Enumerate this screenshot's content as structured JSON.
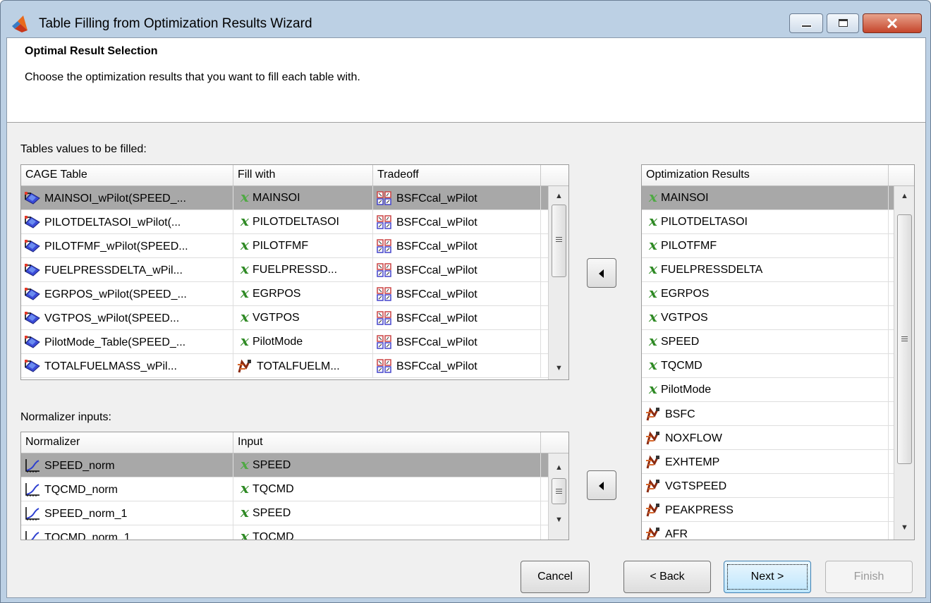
{
  "window": {
    "title": "Table Filling from Optimization Results Wizard",
    "controls": [
      "minimize-icon",
      "maximize-icon",
      "close-icon"
    ]
  },
  "header": {
    "title": "Optimal Result Selection",
    "description": "Choose the optimization results that you want to fill each table with."
  },
  "tables_section": {
    "label": "Tables values to be filled:",
    "columns": [
      "CAGE Table",
      "Fill with",
      "Tradeoff"
    ],
    "rows": [
      {
        "table": "MAINSOI_wPilot(SPEED_...",
        "fill": "MAINSOI",
        "fill_icon": "variable-icon",
        "tradeoff": "BSFCcal_wPilot",
        "selected": true
      },
      {
        "table": "PILOTDELTASOI_wPilot(...",
        "fill": "PILOTDELTASOI",
        "fill_icon": "variable-icon",
        "tradeoff": "BSFCcal_wPilot",
        "selected": false
      },
      {
        "table": "PILOTFMF_wPilot(SPEED...",
        "fill": "PILOTFMF",
        "fill_icon": "variable-icon",
        "tradeoff": "BSFCcal_wPilot",
        "selected": false
      },
      {
        "table": "FUELPRESSDELTA_wPil...",
        "fill": "FUELPRESSD...",
        "fill_icon": "variable-icon",
        "tradeoff": "BSFCcal_wPilot",
        "selected": false
      },
      {
        "table": "EGRPOS_wPilot(SPEED_...",
        "fill": "EGRPOS",
        "fill_icon": "variable-icon",
        "tradeoff": "BSFCcal_wPilot",
        "selected": false
      },
      {
        "table": "VGTPOS_wPilot(SPEED...",
        "fill": "VGTPOS",
        "fill_icon": "variable-icon",
        "tradeoff": "BSFCcal_wPilot",
        "selected": false
      },
      {
        "table": "PilotMode_Table(SPEED_...",
        "fill": "PilotMode",
        "fill_icon": "variable-icon",
        "tradeoff": "BSFCcal_wPilot",
        "selected": false
      },
      {
        "table": "TOTALFUELMASS_wPil...",
        "fill": "TOTALFUELM...",
        "fill_icon": "model-icon",
        "tradeoff": "BSFCcal_wPilot",
        "selected": false
      }
    ]
  },
  "normalizer_section": {
    "label": "Normalizer inputs:",
    "columns": [
      "Normalizer",
      "Input"
    ],
    "rows": [
      {
        "normalizer": "SPEED_norm",
        "input": "SPEED",
        "selected": true
      },
      {
        "normalizer": "TQCMD_norm",
        "input": "TQCMD",
        "selected": false
      },
      {
        "normalizer": "SPEED_norm_1",
        "input": "SPEED",
        "selected": false
      },
      {
        "normalizer": "TQCMD_norm_1",
        "input": "TQCMD",
        "selected": false
      }
    ]
  },
  "results_section": {
    "column": "Optimization Results",
    "rows": [
      {
        "name": "MAINSOI",
        "icon": "variable-icon",
        "selected": true
      },
      {
        "name": "PILOTDELTASOI",
        "icon": "variable-icon",
        "selected": false
      },
      {
        "name": "PILOTFMF",
        "icon": "variable-icon",
        "selected": false
      },
      {
        "name": "FUELPRESSDELTA",
        "icon": "variable-icon",
        "selected": false
      },
      {
        "name": "EGRPOS",
        "icon": "variable-icon",
        "selected": false
      },
      {
        "name": "VGTPOS",
        "icon": "variable-icon",
        "selected": false
      },
      {
        "name": "SPEED",
        "icon": "variable-icon",
        "selected": false
      },
      {
        "name": "TQCMD",
        "icon": "variable-icon",
        "selected": false
      },
      {
        "name": "PilotMode",
        "icon": "variable-icon",
        "selected": false
      },
      {
        "name": "BSFC",
        "icon": "model-icon",
        "selected": false
      },
      {
        "name": "NOXFLOW",
        "icon": "model-icon",
        "selected": false
      },
      {
        "name": "EXHTEMP",
        "icon": "model-icon",
        "selected": false
      },
      {
        "name": "VGTSPEED",
        "icon": "model-icon",
        "selected": false
      },
      {
        "name": "PEAKPRESS",
        "icon": "model-icon",
        "selected": false
      },
      {
        "name": "AFR",
        "icon": "model-icon",
        "selected": false
      }
    ]
  },
  "buttons": {
    "cancel": "Cancel",
    "back": "< Back",
    "next": "Next >",
    "finish": "Finish"
  },
  "colors": {
    "selection": "#a8a8a8",
    "variable_icon": "#2f8a25",
    "title_bar": "#bcd0e4",
    "close_button": "#c5452b"
  }
}
